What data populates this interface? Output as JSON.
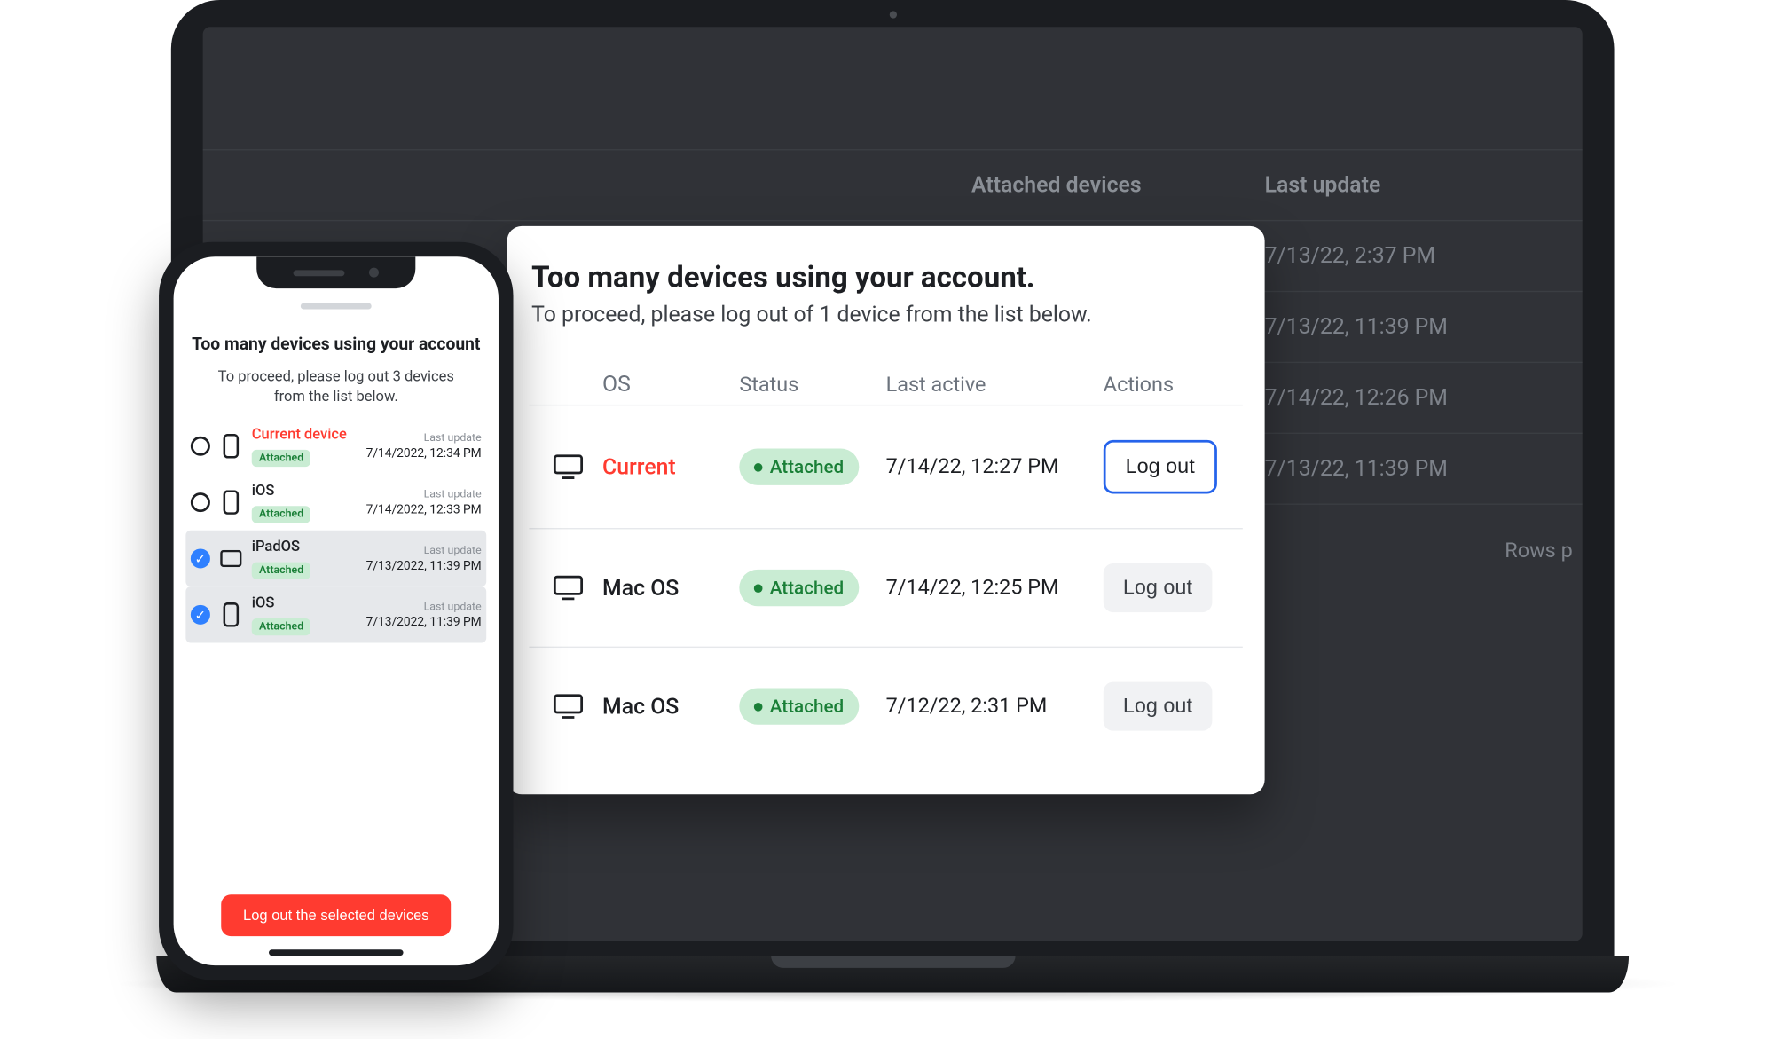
{
  "background": {
    "header_attached": "Attached devices",
    "header_last_update": "Last update",
    "rows": [
      {
        "last_update": "7/13/22, 2:37 PM"
      },
      {
        "last_update": "7/13/22, 11:39 PM"
      },
      {
        "last_update": "7/14/22, 12:26 PM"
      },
      {
        "last_update": "7/13/22, 11:39 PM"
      }
    ],
    "rows_per_page_label": "Rows p"
  },
  "desktop_modal": {
    "title": "Too many devices using your account.",
    "subtitle": "To proceed, please log out of 1 device from the list below.",
    "columns": {
      "os": "OS",
      "status": "Status",
      "last_active": "Last active",
      "actions": "Actions"
    },
    "status_label": "Attached",
    "logout_label": "Log out",
    "rows": [
      {
        "os": "Current",
        "is_current": true,
        "last_active": "7/14/22, 12:27 PM",
        "primary": true
      },
      {
        "os": "Mac OS",
        "is_current": false,
        "last_active": "7/14/22, 12:25 PM",
        "primary": false
      },
      {
        "os": "Mac OS",
        "is_current": false,
        "last_active": "7/12/22, 2:31 PM",
        "primary": false
      }
    ]
  },
  "phone_modal": {
    "title": "Too many devices using your account",
    "subtitle": "To proceed, please log out 3 devices from the list below.",
    "last_update_label": "Last update",
    "status_label": "Attached",
    "logout_button": "Log out the selected devices",
    "rows": [
      {
        "os": "Current device",
        "is_current": true,
        "device": "phone",
        "time": "7/14/2022, 12:34 PM",
        "selected": false
      },
      {
        "os": "iOS",
        "is_current": false,
        "device": "phone",
        "time": "7/14/2022, 12:33 PM",
        "selected": false
      },
      {
        "os": "iPadOS",
        "is_current": false,
        "device": "tablet",
        "time": "7/13/2022, 11:39 PM",
        "selected": true
      },
      {
        "os": "iOS",
        "is_current": false,
        "device": "phone",
        "time": "7/13/2022, 11:39 PM",
        "selected": true
      }
    ]
  }
}
